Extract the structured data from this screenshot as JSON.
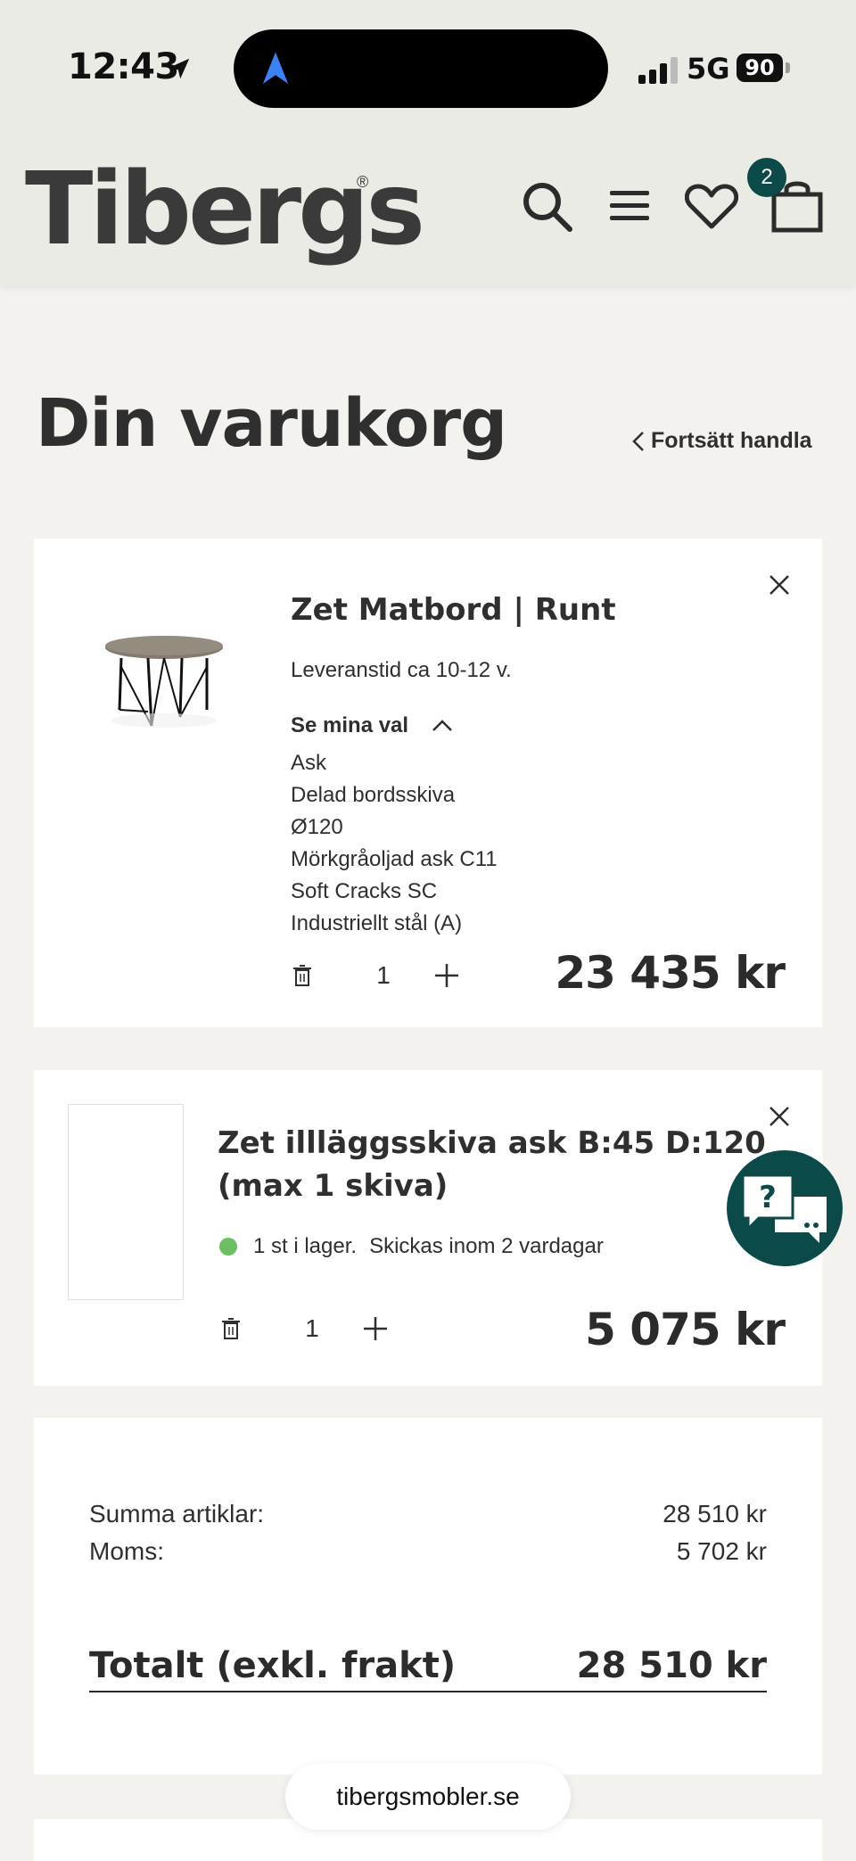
{
  "status_bar": {
    "time": "12:43",
    "network": "5G",
    "battery": "90"
  },
  "header": {
    "logo": "Tibergs",
    "logo_mark": "®",
    "cart_count": "2"
  },
  "page": {
    "title": "Din varukorg",
    "continue_shopping": "Fortsätt handla"
  },
  "cart_items": [
    {
      "name": "Zet Matbord | Runt",
      "lead_time": "Leveranstid ca 10-12 v.",
      "toggle_label": "Se mina val",
      "options": [
        "Ask",
        "Delad bordsskiva",
        "Ø120",
        "Mörkgråoljad ask C11",
        "Soft Cracks SC",
        "Industriellt stål (A)"
      ],
      "quantity": "1",
      "price": "23 435 kr"
    },
    {
      "name_line1": "Zet illläggsskiva ask B:45 D:120",
      "name_line2": "(max 1 skiva)",
      "stock_count": "1 st i lager.",
      "stock_shipping": "Skickas inom 2 vardagar",
      "quantity": "1",
      "price": "5 075 kr"
    }
  ],
  "summary": {
    "items_label": "Summa artiklar:",
    "items_value": "28 510 kr",
    "vat_label": "Moms:",
    "vat_value": "5 702 kr",
    "total_label": "Totalt (exkl. frakt)",
    "total_value": "28 510 kr"
  },
  "chat": {
    "icon": "?"
  },
  "browser": {
    "url": "tibergsmobler.se"
  },
  "colors": {
    "accent": "#0c4a4a",
    "stock": "#6cbf62",
    "header_bg": "#ebebe5",
    "page_bg": "#f3f2ef"
  }
}
